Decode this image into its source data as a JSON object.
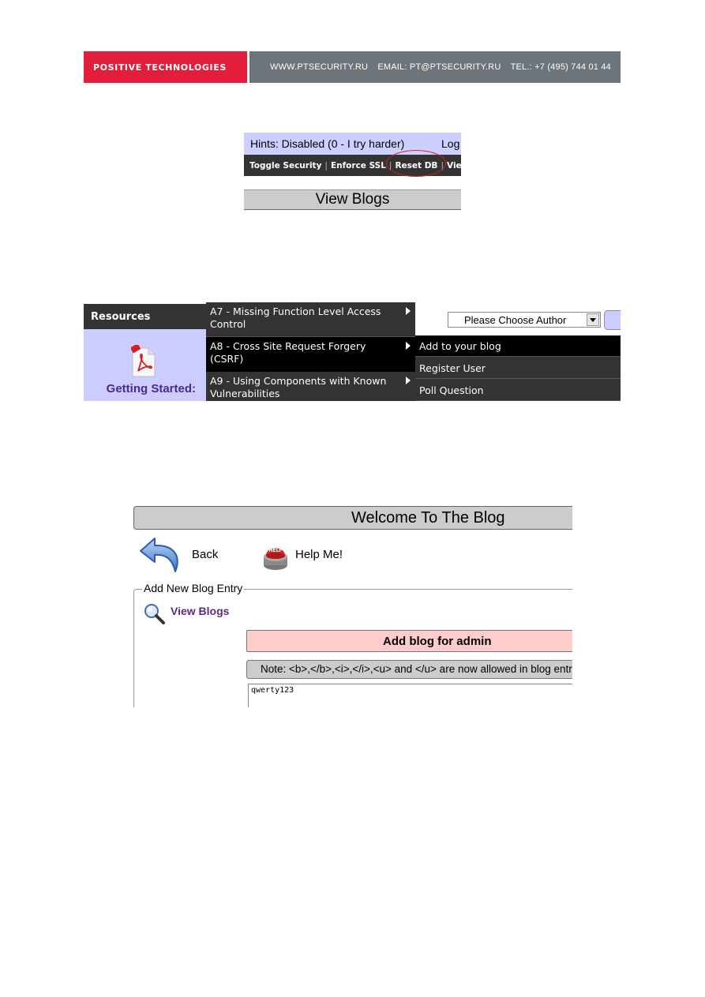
{
  "banner": {
    "brand": "POSITIVE TECHNOLOGIES",
    "website": "WWW.PTSECURITY.RU",
    "email": "EMAIL: PT@PTSECURITY.RU",
    "phone": "TEL.: +7 (495) 744 01 44",
    "colors": {
      "brand_bg": "#e41d3d",
      "info_bg": "#6d747a"
    }
  },
  "screenshot1": {
    "hints_text": "Hints: Disabled (0 - I try harder)",
    "log_text": "Log",
    "menu": {
      "toggle_security": "Toggle Security",
      "enforce_ssl": "Enforce SSL",
      "reset_db": "Reset DB",
      "view_partial": "Vie",
      "separator": "|"
    },
    "page_title": "View Blogs"
  },
  "screenshot2": {
    "resources_label": "Resources",
    "getting_started": "Getting Started:",
    "owasp_items": [
      {
        "label": "A7 - Missing Function Level Access Control"
      },
      {
        "label": "A8 - Cross Site Request Forgery (CSRF)"
      },
      {
        "label": "A9 - Using Components with Known Vulnerabilities"
      }
    ],
    "submenu": [
      {
        "label": "Add to your blog"
      },
      {
        "label": "Register User"
      },
      {
        "label": "Poll Question"
      }
    ],
    "author_select": "Please Choose Author"
  },
  "screenshot3": {
    "welcome_title": "Welcome To The Blog",
    "back_label": "Back",
    "help_label": "Help Me!",
    "help_badge": "HELP",
    "legend": "Add New Blog Entry",
    "view_blogs_link": "View Blogs",
    "add_blog_title": "Add blog for admin",
    "note": "Note: <b>,</b>,<i>,</i>,<u> and </u> are now allowed in blog entries",
    "textarea_value": "qwerty123"
  }
}
